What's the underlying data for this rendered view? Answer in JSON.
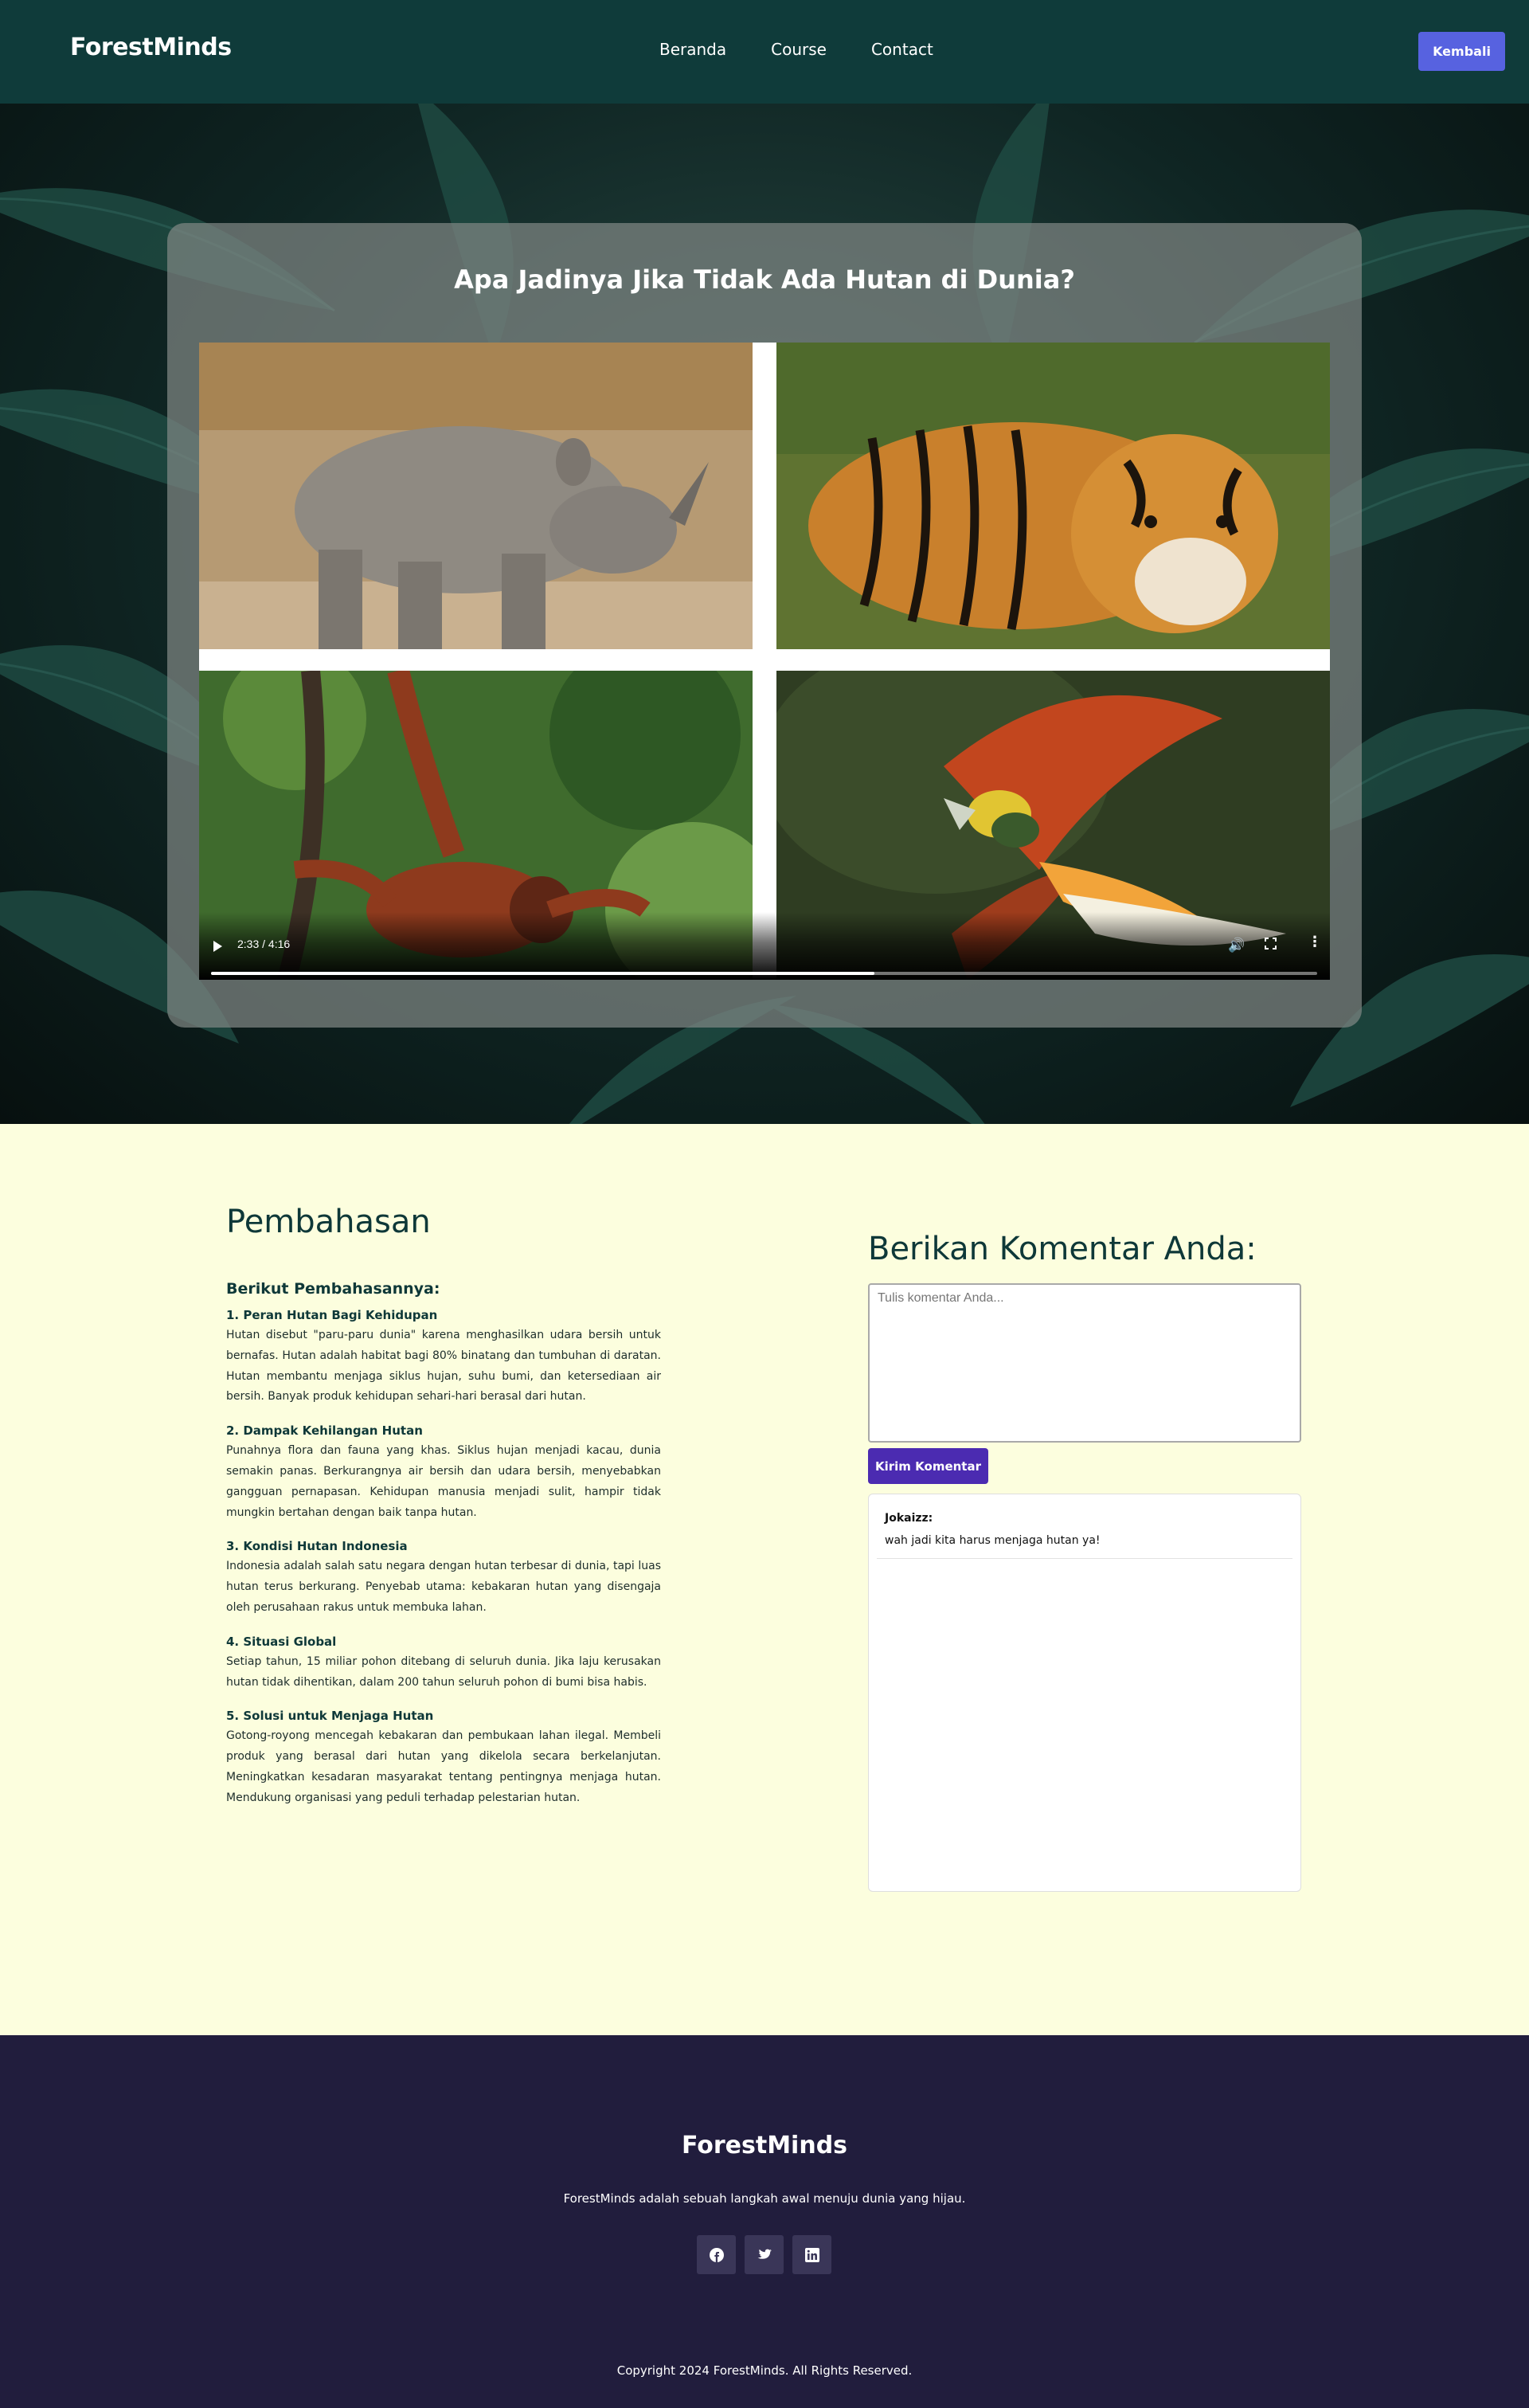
{
  "header": {
    "brand": "ForestMinds",
    "nav": [
      "Beranda",
      "Course",
      "Contact"
    ],
    "back_label": "Kembali"
  },
  "hero": {
    "title": "Apa Jadinya Jika Tidak Ada Hutan di Dunia?",
    "video": {
      "time": "2:33 / 4:16",
      "progress": 0.6,
      "tiles": [
        "rhino",
        "tiger",
        "orangutan",
        "bird-of-paradise"
      ]
    }
  },
  "pembahasan": {
    "title": "Pembahasan",
    "subtitle": "Berikut Pembahasannya:",
    "items": [
      {
        "heading": "1. Peran Hutan Bagi Kehidupan",
        "text": "Hutan disebut \"paru-paru dunia\" karena menghasilkan udara bersih untuk bernafas. Hutan adalah habitat bagi 80% binatang dan tumbuhan di daratan. Hutan membantu menjaga siklus hujan, suhu bumi, dan ketersediaan air bersih. Banyak produk kehidupan sehari-hari berasal dari hutan."
      },
      {
        "heading": "2. Dampak Kehilangan Hutan",
        "text": "Punahnya flora dan fauna yang khas. Siklus hujan menjadi kacau, dunia semakin panas. Berkurangnya air bersih dan udara bersih, menyebabkan gangguan pernapasan. Kehidupan manusia menjadi sulit, hampir tidak mungkin bertahan dengan baik tanpa hutan."
      },
      {
        "heading": "3. Kondisi Hutan Indonesia",
        "text": "Indonesia adalah salah satu negara dengan hutan terbesar di dunia, tapi luas hutan terus berkurang. Penyebab utama: kebakaran hutan yang disengaja oleh perusahaan rakus untuk membuka lahan."
      },
      {
        "heading": "4. Situasi Global",
        "text": "Setiap tahun, 15 miliar pohon ditebang di seluruh dunia. Jika laju kerusakan hutan tidak dihentikan, dalam 200 tahun seluruh pohon di bumi bisa habis."
      },
      {
        "heading": "5. Solusi untuk Menjaga Hutan",
        "text": "Gotong-royong mencegah kebakaran dan pembukaan lahan ilegal. Membeli produk yang berasal dari hutan yang dikelola secara berkelanjutan. Meningkatkan kesadaran masyarakat tentang pentingnya menjaga hutan. Mendukung organisasi yang peduli terhadap pelestarian hutan."
      }
    ]
  },
  "comments": {
    "title": "Berikan Komentar Anda:",
    "placeholder": "Tulis komentar Anda...",
    "send_label": "Kirim Komentar",
    "list": [
      {
        "author": "Jokaizz:",
        "text": "wah jadi kita harus menjaga hutan ya!"
      }
    ]
  },
  "footer": {
    "brand": "ForestMinds",
    "tagline": "ForestMinds adalah sebuah langkah awal menuju dunia yang hijau.",
    "social": [
      "facebook-icon",
      "twitter-icon",
      "linkedin-icon"
    ],
    "copyright": "Copyright 2024 ForestMinds. All Rights Reserved."
  },
  "colors": {
    "header_bg": "#0f3b3a",
    "accent_button": "#5762e0",
    "send_button": "#4b2bb1",
    "content_bg": "#fcfede",
    "footer_bg": "#211d3d"
  }
}
